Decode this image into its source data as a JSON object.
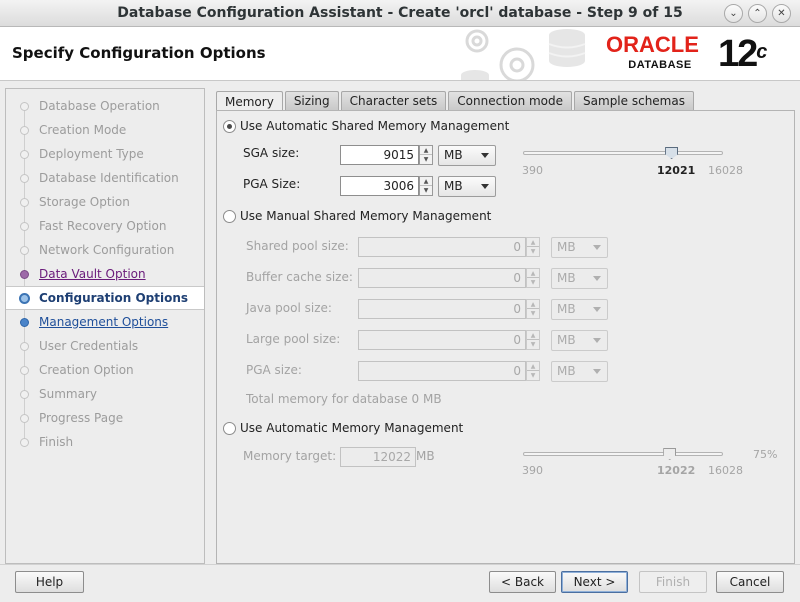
{
  "window": {
    "title": "Database Configuration Assistant - Create 'orcl' database - Step 9 of 15"
  },
  "header": {
    "page_title": "Specify Configuration Options",
    "logo_oracle": "ORACLE",
    "logo_database": "DATABASE",
    "version": "12",
    "version_suffix": "c",
    "brand_color": "#e2231a"
  },
  "steps": [
    {
      "label": "Database Operation",
      "state": "done"
    },
    {
      "label": "Creation Mode",
      "state": "done"
    },
    {
      "label": "Deployment Type",
      "state": "done"
    },
    {
      "label": "Database Identification",
      "state": "done"
    },
    {
      "label": "Storage Option",
      "state": "done"
    },
    {
      "label": "Fast Recovery Option",
      "state": "done"
    },
    {
      "label": "Network Configuration",
      "state": "done"
    },
    {
      "label": "Data Vault Option",
      "state": "visited"
    },
    {
      "label": "Configuration Options",
      "state": "current"
    },
    {
      "label": "Management Options",
      "state": "next"
    },
    {
      "label": "User Credentials",
      "state": "pending"
    },
    {
      "label": "Creation Option",
      "state": "pending"
    },
    {
      "label": "Summary",
      "state": "pending"
    },
    {
      "label": "Progress Page",
      "state": "pending"
    },
    {
      "label": "Finish",
      "state": "pending"
    }
  ],
  "tabs": [
    {
      "label": "Memory",
      "active": true
    },
    {
      "label": "Sizing",
      "active": false
    },
    {
      "label": "Character sets",
      "active": false
    },
    {
      "label": "Connection mode",
      "active": false
    },
    {
      "label": "Sample schemas",
      "active": false
    }
  ],
  "memory": {
    "asmm": {
      "label": "Use Automatic Shared Memory Management",
      "selected": true,
      "sga_label": "SGA size:",
      "sga_value": "9015",
      "sga_unit": "MB",
      "pga_label": "PGA Size:",
      "pga_value": "3006",
      "pga_unit": "MB",
      "slider_min": "390",
      "slider_max": "16028",
      "slider_value": "12021",
      "slider_fraction": 0.76
    },
    "manual": {
      "label": "Use Manual Shared Memory Management",
      "selected": false,
      "fields": [
        {
          "label": "Shared pool size:",
          "value": "0",
          "unit": "MB"
        },
        {
          "label": "Buffer cache size:",
          "value": "0",
          "unit": "MB"
        },
        {
          "label": "Java pool size:",
          "value": "0",
          "unit": "MB"
        },
        {
          "label": "Large pool size:",
          "value": "0",
          "unit": "MB"
        },
        {
          "label": "PGA size:",
          "value": "0",
          "unit": "MB"
        }
      ],
      "total": "Total memory for database 0 MB"
    },
    "amm": {
      "label": "Use Automatic Memory Management",
      "selected": false,
      "target_label": "Memory target:",
      "target_value": "12022",
      "target_unit": "MB",
      "slider_min": "390",
      "slider_max": "16028",
      "slider_value": "12022",
      "percent": "75%",
      "slider_fraction": 0.75
    }
  },
  "buttons": {
    "help": "Help",
    "back": "< Back",
    "next": "Next >",
    "finish": "Finish",
    "cancel": "Cancel"
  }
}
